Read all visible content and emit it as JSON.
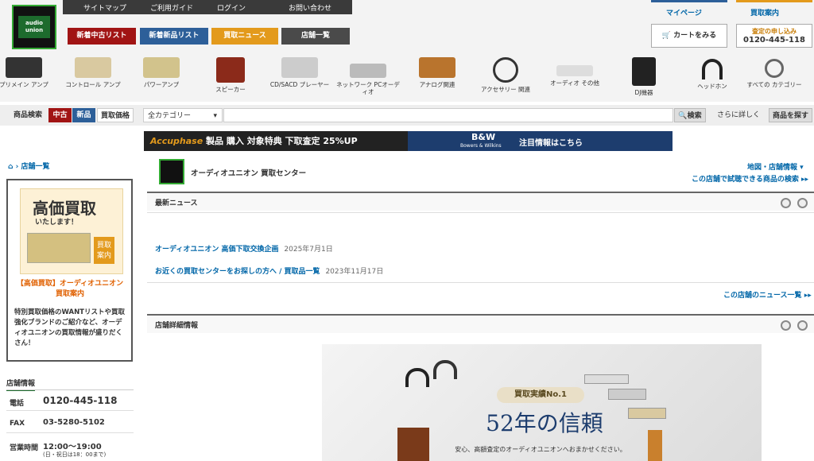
{
  "header": {
    "util_links": [
      "サイトマップ",
      "ご利用ガイド",
      "ログイン",
      "お問い合わせ"
    ],
    "tabs": [
      "新着中古リスト",
      "新着新品リスト",
      "買取ニュース",
      "店舗一覧"
    ],
    "logo_text": "audio union",
    "mypage": "マイページ",
    "kaitori_annai": "買取案内",
    "cart": "カートをみる",
    "satei_label": "査定の申し込み",
    "satei_tel": "0120-445-118",
    "colors": {
      "tab1": "#a11414",
      "tab2": "#2d5f99",
      "tab3": "#e39a1c",
      "tab4": "#4a4a4a",
      "accent": "#0066a8"
    }
  },
  "categories": [
    "プリメイン アンプ",
    "コントロール アンプ",
    "パワーアンプ",
    "スピーカー",
    "CD/SACD プレーヤー",
    "ネットワーク PCオーディオ",
    "アナログ関連",
    "アクセサリー 関連",
    "オーディオ その他",
    "DJ機器",
    "ヘッドホン",
    "すべての カテゴリー"
  ],
  "search": {
    "label": "商品検索",
    "mode_used": "中古",
    "mode_new": "新品",
    "mode_buy": "買取価格",
    "category_select": "全カテゴリー",
    "search_btn": "検索",
    "detail": "さらに詳しく",
    "find_btn": "商品を探す"
  },
  "banner": {
    "left_brand": "Accuphase",
    "left_text": "製品 購入 対象特典 下取査定 25%UP",
    "right_brand": "B&W",
    "right_sub": "Bowers & Wilkins",
    "right_text": "注目情報はこちら"
  },
  "sidebar": {
    "breadcrumb": "店舗一覧",
    "promo_title": "高価買取",
    "promo_sub": "いたします！",
    "promo_badge": "買取 案内",
    "promo_link": "【高価買取】オーディオユニオン 買取案内",
    "promo_desc": "特別買取価格のWANTリストや買取強化ブランドのご紹介など、オーディオユニオンの買取情報が盛りだくさん！",
    "store_info_title": "店舗情報",
    "rows": [
      {
        "label": "電話",
        "value": "0120-445-118"
      },
      {
        "label": "FAX",
        "value": "03-5280-5102"
      },
      {
        "label": "営業時間",
        "value": "12:00〜19:00",
        "note": "(日・祝日は18：00まで)"
      }
    ]
  },
  "store": {
    "name": "オーディオユニオン 買取センター",
    "map_link": "地図・店舗情報",
    "trial_link": "この店舗で試聴できる商品の検索"
  },
  "news": {
    "title": "最新ニュース",
    "items": [
      {
        "text": "オーディオユニオン 高価下取交換企画",
        "date": "2025年7月1日"
      },
      {
        "text": "お近くの買取センターをお探しの方へ / 買取品一覧",
        "date": "2023年11月17日"
      }
    ],
    "more": "この店舗のニュース一覧"
  },
  "detail": {
    "title": "店舗詳細情報",
    "hero_badge": "買取実績No.1",
    "hero_big": "52年の信頼",
    "hero_sub": "安心、高額査定のオーディオユニオンへおまかせください。"
  }
}
